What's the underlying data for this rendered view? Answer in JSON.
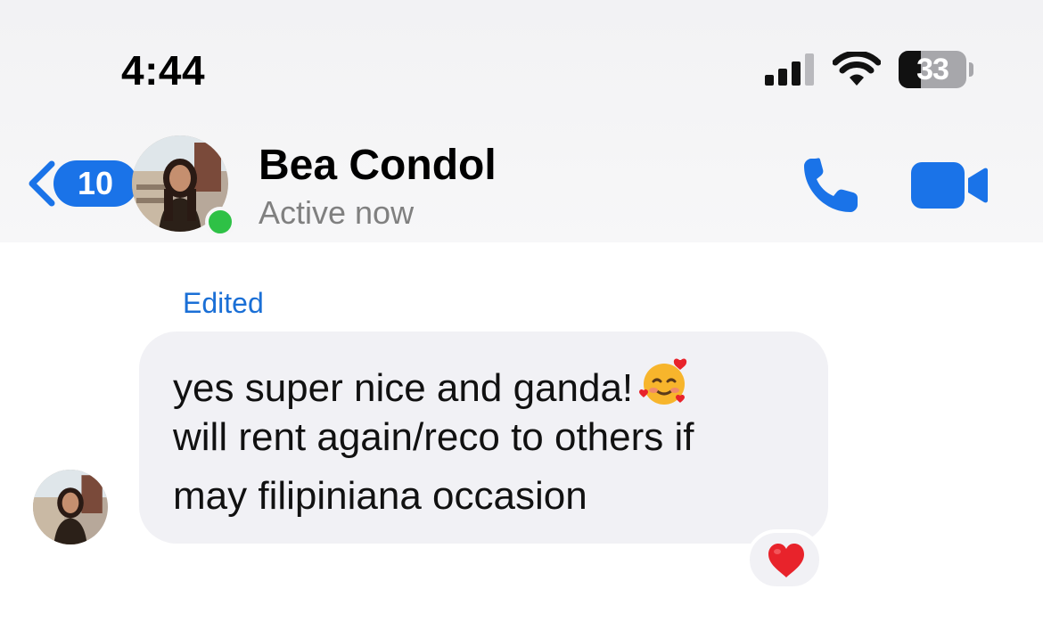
{
  "status_bar": {
    "time": "4:44",
    "battery_percent": "33",
    "battery_level": 0.33,
    "icons": [
      "signal-icon",
      "wifi-icon",
      "battery-icon"
    ]
  },
  "header": {
    "back_icon": "chevron-left-icon",
    "unread_count": "10",
    "contact_name": "Bea Condol",
    "contact_status": "Active now",
    "online": true,
    "actions": [
      "phone-icon",
      "video-camera-icon"
    ],
    "accent_color": "#1a73e8",
    "online_color": "#2ec146"
  },
  "conversation": {
    "edited_label": "Edited",
    "message": {
      "lines": [
        "yes super nice and ganda!",
        "will rent again/reco to others if",
        "may filipiniana occasion"
      ],
      "inline_emoji": "smiling-face-with-hearts",
      "reaction": "red-heart"
    }
  }
}
